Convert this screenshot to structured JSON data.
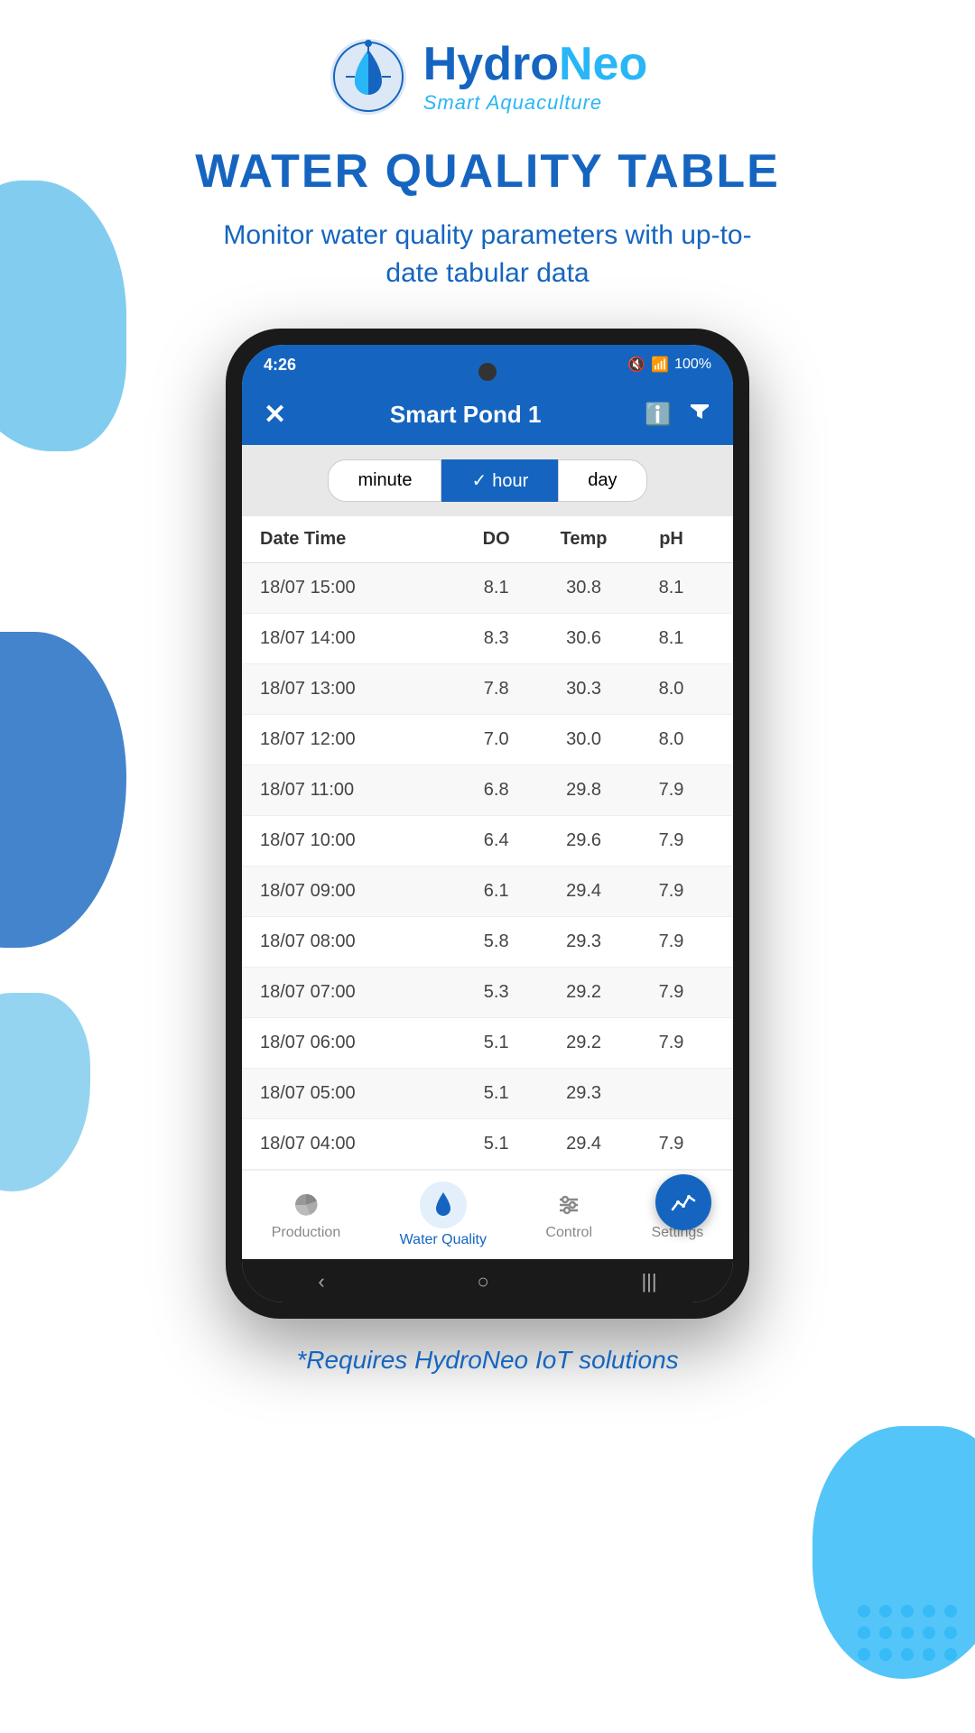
{
  "logo": {
    "hydro": "Hydro",
    "neo": "Neo",
    "tagline": "Smart Aquaculture"
  },
  "page": {
    "title": "WATER QUALITY TABLE",
    "subtitle": "Monitor water quality parameters with up-to-date tabular data",
    "footer": "*Requires HydroNeo IoT solutions"
  },
  "phone": {
    "status": {
      "time": "4:26",
      "battery": "100%",
      "signal": "📶"
    },
    "header": {
      "title": "Smart Pond 1",
      "close_label": "✕"
    },
    "filter": {
      "options": [
        "minute",
        "hour",
        "day"
      ],
      "active": "hour"
    },
    "table": {
      "headers": [
        "Date Time",
        "DO",
        "Temp",
        "pH"
      ],
      "rows": [
        {
          "datetime": "18/07  15:00",
          "do": "8.1",
          "temp": "30.8",
          "ph": "8.1"
        },
        {
          "datetime": "18/07  14:00",
          "do": "8.3",
          "temp": "30.6",
          "ph": "8.1"
        },
        {
          "datetime": "18/07  13:00",
          "do": "7.8",
          "temp": "30.3",
          "ph": "8.0"
        },
        {
          "datetime": "18/07  12:00",
          "do": "7.0",
          "temp": "30.0",
          "ph": "8.0"
        },
        {
          "datetime": "18/07  11:00",
          "do": "6.8",
          "temp": "29.8",
          "ph": "7.9"
        },
        {
          "datetime": "18/07  10:00",
          "do": "6.4",
          "temp": "29.6",
          "ph": "7.9"
        },
        {
          "datetime": "18/07  09:00",
          "do": "6.1",
          "temp": "29.4",
          "ph": "7.9"
        },
        {
          "datetime": "18/07  08:00",
          "do": "5.8",
          "temp": "29.3",
          "ph": "7.9"
        },
        {
          "datetime": "18/07  07:00",
          "do": "5.3",
          "temp": "29.2",
          "ph": "7.9"
        },
        {
          "datetime": "18/07  06:00",
          "do": "5.1",
          "temp": "29.2",
          "ph": "7.9"
        },
        {
          "datetime": "18/07  05:00",
          "do": "5.1",
          "temp": "29.3",
          "ph": ""
        },
        {
          "datetime": "18/07  04:00",
          "do": "5.1",
          "temp": "29.4",
          "ph": "7.9"
        }
      ]
    },
    "nav": {
      "items": [
        {
          "label": "Production",
          "active": false
        },
        {
          "label": "Water Quality",
          "active": true
        },
        {
          "label": "Control",
          "active": false
        },
        {
          "label": "Settings",
          "active": false
        }
      ]
    },
    "home_bar": [
      "‹",
      "○",
      "|||"
    ]
  }
}
